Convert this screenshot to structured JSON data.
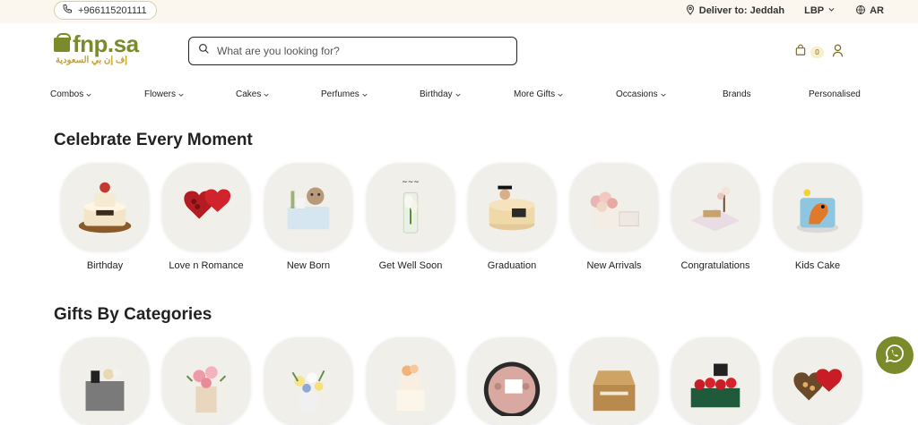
{
  "topbar": {
    "phone": "+966115201111",
    "deliver_label": "Deliver to: Jeddah",
    "currency": "LBP",
    "language": "AR"
  },
  "logo": {
    "main": "fnp.sa",
    "sub": "إف إن بي السعودية"
  },
  "search": {
    "placeholder": "What are you looking for?"
  },
  "cart": {
    "count": "0"
  },
  "nav": [
    {
      "label": "Combos"
    },
    {
      "label": "Flowers"
    },
    {
      "label": "Cakes"
    },
    {
      "label": "Perfumes"
    },
    {
      "label": "Birthday"
    },
    {
      "label": "More Gifts"
    },
    {
      "label": "Occasions"
    },
    {
      "label": "Brands"
    },
    {
      "label": "Personalised"
    }
  ],
  "sections": {
    "celebrate_title": "Celebrate Every Moment",
    "gifts_title": "Gifts By Categories"
  },
  "celebrate_items": [
    {
      "label": "Birthday",
      "icon": "birthday-cake-icon"
    },
    {
      "label": "Love n Romance",
      "icon": "heart-box-icon"
    },
    {
      "label": "New Born",
      "icon": "baby-basket-icon"
    },
    {
      "label": "Get Well Soon",
      "icon": "flower-vase-icon"
    },
    {
      "label": "Graduation",
      "icon": "graduation-cake-icon"
    },
    {
      "label": "New Arrivals",
      "icon": "flower-box-icon"
    },
    {
      "label": "Congratulations",
      "icon": "gift-tray-icon"
    },
    {
      "label": "Kids Cake",
      "icon": "kids-cake-icon"
    }
  ],
  "gift_items": [
    {
      "icon": "gift-basket-icon"
    },
    {
      "icon": "rose-bouquet-icon"
    },
    {
      "icon": "flower-arrangement-icon"
    },
    {
      "icon": "cake-icon"
    },
    {
      "icon": "round-flower-box-icon"
    },
    {
      "icon": "picnic-hamper-icon"
    },
    {
      "icon": "rose-box-icon"
    },
    {
      "icon": "chocolate-heart-icon"
    }
  ],
  "colors": {
    "brand": "#7b8a2b",
    "topbar_bg": "#fbf7ef",
    "tile_bg": "#f1efe9"
  }
}
